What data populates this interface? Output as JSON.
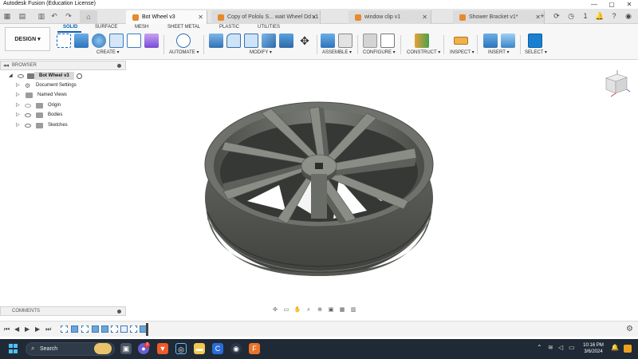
{
  "window": {
    "title": "Autodesk Fusion (Education License)",
    "controls": [
      "—",
      "▢",
      "✕"
    ]
  },
  "tabs": [
    {
      "label": "Bot Wheel v3",
      "active": true
    },
    {
      "label": "Copy of Pololu S... wait Wheel Dd v1",
      "active": false
    },
    {
      "label": "window clip v1",
      "active": false
    },
    {
      "label": "Shower Bracket v1*",
      "active": false
    }
  ],
  "top_right": {
    "count": "1"
  },
  "ribbon": {
    "design_label": "DESIGN ▾",
    "workspace_tabs": [
      "SOLID",
      "SURFACE",
      "MESH",
      "SHEET METAL",
      "PLASTIC",
      "UTILITIES"
    ],
    "groups": [
      "CREATE ▾",
      "AUTOMATE ▾",
      "MODIFY ▾",
      "ASSEMBLE ▾",
      "CONFIGURE ▾",
      "CONSTRUCT ▾",
      "INSPECT ▾",
      "INSERT ▾",
      "SELECT ▾"
    ]
  },
  "browser": {
    "header": "BROWSER",
    "root": "Bot Wheel v3",
    "items": [
      "Document Settings",
      "Named Views",
      "Origin",
      "Bodies",
      "Sketches"
    ]
  },
  "comments": {
    "header": "COMMENTS"
  },
  "taskbar": {
    "search_label": "Search",
    "time": "10:16 PM",
    "date": "3/6/2024",
    "notification_count": "3"
  },
  "colors": {
    "accent": "#0a64b4",
    "model_body": "#5c5f5a",
    "taskbar_bg": "#1f2a36"
  }
}
